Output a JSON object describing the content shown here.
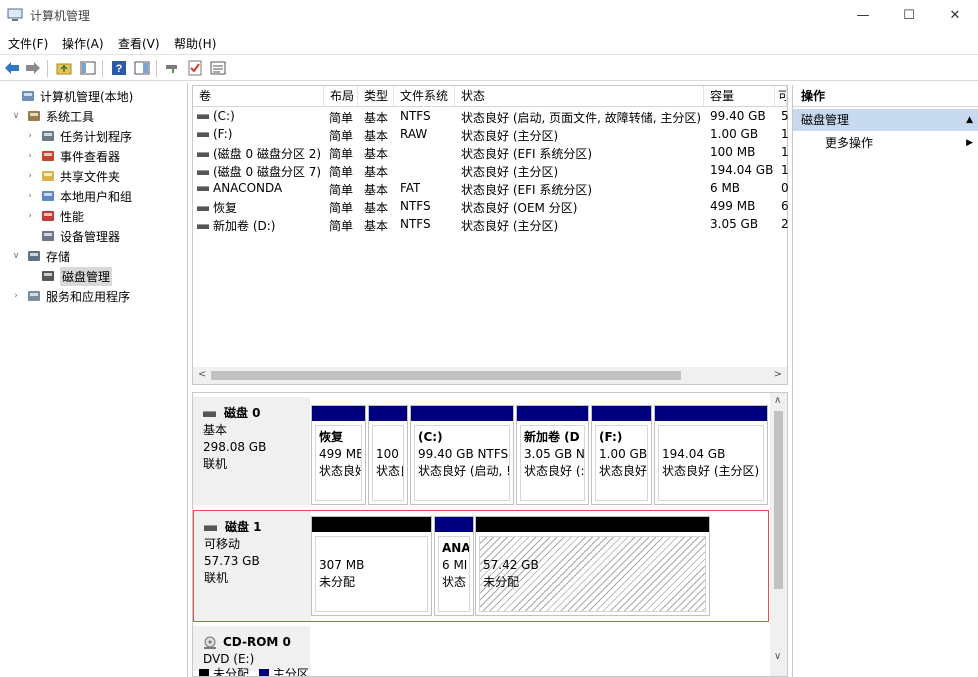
{
  "window": {
    "title": "计算机管理",
    "minimize_glyph": "—",
    "maximize_glyph": "☐",
    "close_glyph": "✕"
  },
  "menu": [
    "文件(F)",
    "操作(A)",
    "查看(V)",
    "帮助(H)"
  ],
  "toolbar": {
    "icons": [
      "back-arrow-icon",
      "forward-arrow-icon",
      "up-folder-icon",
      "show-hide-tree-icon",
      "help-icon",
      "properties-pane-icon",
      "connect-icon",
      "check-icon",
      "list-view-icon"
    ]
  },
  "tree": {
    "items": [
      {
        "label": "计算机管理(本地)",
        "level": 0,
        "expander": "",
        "icon": "computer-management-icon"
      },
      {
        "label": "系统工具",
        "level": 1,
        "expander": "∨",
        "icon": "tools-icon"
      },
      {
        "label": "任务计划程序",
        "level": 2,
        "expander": "›",
        "icon": "clock-icon"
      },
      {
        "label": "事件查看器",
        "level": 2,
        "expander": "›",
        "icon": "event-viewer-icon"
      },
      {
        "label": "共享文件夹",
        "level": 2,
        "expander": "›",
        "icon": "shared-folder-icon"
      },
      {
        "label": "本地用户和组",
        "level": 2,
        "expander": "›",
        "icon": "users-icon"
      },
      {
        "label": "性能",
        "level": 2,
        "expander": "›",
        "icon": "performance-icon"
      },
      {
        "label": "设备管理器",
        "level": 2,
        "expander": "",
        "icon": "device-manager-icon"
      },
      {
        "label": "存储",
        "level": 1,
        "expander": "∨",
        "icon": "storage-icon"
      },
      {
        "label": "磁盘管理",
        "level": 2,
        "expander": "",
        "icon": "disk-management-icon",
        "selected": true
      },
      {
        "label": "服务和应用程序",
        "level": 1,
        "expander": "›",
        "icon": "services-icon"
      }
    ]
  },
  "volume_list": {
    "columns": [
      "卷",
      "布局",
      "类型",
      "文件系统",
      "状态",
      "容量",
      "可"
    ],
    "rows": [
      [
        "(C:)",
        "简单",
        "基本",
        "NTFS",
        "状态良好 (启动, 页面文件, 故障转储, 主分区)",
        "99.40 GB",
        "5"
      ],
      [
        "(F:)",
        "简单",
        "基本",
        "RAW",
        "状态良好 (主分区)",
        "1.00 GB",
        "1"
      ],
      [
        "(磁盘 0 磁盘分区 2)",
        "简单",
        "基本",
        "",
        "状态良好 (EFI 系统分区)",
        "100 MB",
        "1"
      ],
      [
        "(磁盘 0 磁盘分区 7)",
        "简单",
        "基本",
        "",
        "状态良好 (主分区)",
        "194.04 GB",
        "1"
      ],
      [
        "ANACONDA",
        "简单",
        "基本",
        "FAT",
        "状态良好 (EFI 系统分区)",
        "6 MB",
        "0"
      ],
      [
        "恢复",
        "简单",
        "基本",
        "NTFS",
        "状态良好 (OEM 分区)",
        "499 MB",
        "6"
      ],
      [
        "新加卷 (D:)",
        "简单",
        "基本",
        "NTFS",
        "状态良好 (主分区)",
        "3.05 GB",
        "2"
      ]
    ],
    "scroll_left": "<",
    "scroll_right": ">"
  },
  "disks": [
    {
      "name": "磁盘 0",
      "type": "基本",
      "size": "298.08 GB",
      "status": "联机",
      "partitions": [
        {
          "bar_color": "#00007f",
          "lines": [
            "恢复",
            "499 MB",
            "状态良好"
          ]
        },
        {
          "bar_color": "#00007f",
          "lines": [
            "",
            "100",
            "状态良"
          ]
        },
        {
          "bar_color": "#00007f",
          "lines": [
            "(C:)",
            "99.40 GB NTFS",
            "状态良好 (启动, !"
          ]
        },
        {
          "bar_color": "#00007f",
          "lines": [
            "新加卷 (D",
            "3.05 GB N",
            "状态良好 (:"
          ]
        },
        {
          "bar_color": "#00007f",
          "lines": [
            "(F:)",
            "1.00 GB",
            "状态良好"
          ]
        },
        {
          "bar_color": "#00007f",
          "lines": [
            "",
            "194.04 GB",
            "状态良好 (主分区)"
          ]
        }
      ]
    },
    {
      "name": "磁盘 1",
      "type": "可移动",
      "size": "57.73 GB",
      "status": "联机",
      "partitions": [
        {
          "bar_color": "#000000",
          "lines": [
            "",
            "307 MB",
            "未分配"
          ]
        },
        {
          "bar_color": "#00007f",
          "lines": [
            "ANA",
            "6 MI",
            "状态"
          ]
        },
        {
          "bar_color": "#000000",
          "lines": [
            "",
            "57.42 GB",
            "未分配"
          ],
          "hatched": true
        }
      ]
    },
    {
      "name": "CD-ROM 0",
      "type": "DVD (E:)"
    }
  ],
  "legend": [
    {
      "label": "未分配",
      "color": "#000000"
    },
    {
      "label": "主分区",
      "color": "#00007f"
    }
  ],
  "actions": {
    "header": "操作",
    "section": "磁盘管理",
    "section_arrow": "▲",
    "more": "更多操作",
    "more_arrow": "▶"
  },
  "colors": {
    "selection_border": "#e05050",
    "action_section_bg": "#c6d9ee"
  }
}
